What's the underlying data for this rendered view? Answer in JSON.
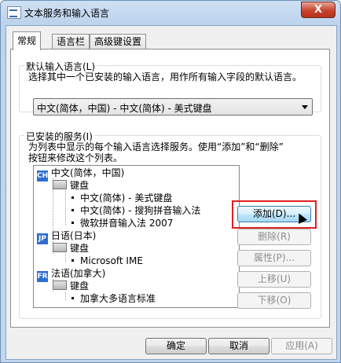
{
  "window": {
    "title": "文本服务和输入语言",
    "close_label": "X"
  },
  "tabs": [
    {
      "label": "常规",
      "active": true
    },
    {
      "label": "语言栏",
      "active": false
    },
    {
      "label": "高级键设置",
      "active": false
    }
  ],
  "default_language": {
    "legend": "默认输入语言(L)",
    "description": "选择其中一个已安装的输入语言，用作所有输入字段的默认语言。",
    "selected": "中文(简体，中国) - 中文(简体) - 美式键盘"
  },
  "installed_services": {
    "legend": "已安装的服务(I)",
    "description_line1": "为列表中显示的每个输入语言选择服务。使用“添加”和“删除”",
    "description_line2": "按钮来修改这个列表。",
    "languages": [
      {
        "badge": "CH",
        "name": "中文(简体，中国)",
        "keyboard_label": "键盘",
        "services": [
          "中文(简体) - 美式键盘",
          "中文(简体) - 搜狗拼音输入法",
          "微软拼音输入法 2007"
        ]
      },
      {
        "badge": "JP",
        "name": "日语(日本)",
        "keyboard_label": "键盘",
        "services": [
          "Microsoft IME"
        ]
      },
      {
        "badge": "FR",
        "name": "法语(加拿大)",
        "keyboard_label": "键盘",
        "services": [
          "加拿大多语言标准"
        ]
      }
    ]
  },
  "side_buttons": {
    "add": "添加(D)...",
    "remove": "删除(R)",
    "properties": "属性(P)...",
    "move_up": "上移(U)",
    "move_down": "下移(O)"
  },
  "footer": {
    "ok": "确定",
    "cancel": "取消",
    "apply": "应用(A)"
  },
  "colors": {
    "badge_blue": "#2f6dd0",
    "highlight_red": "#e02020"
  }
}
